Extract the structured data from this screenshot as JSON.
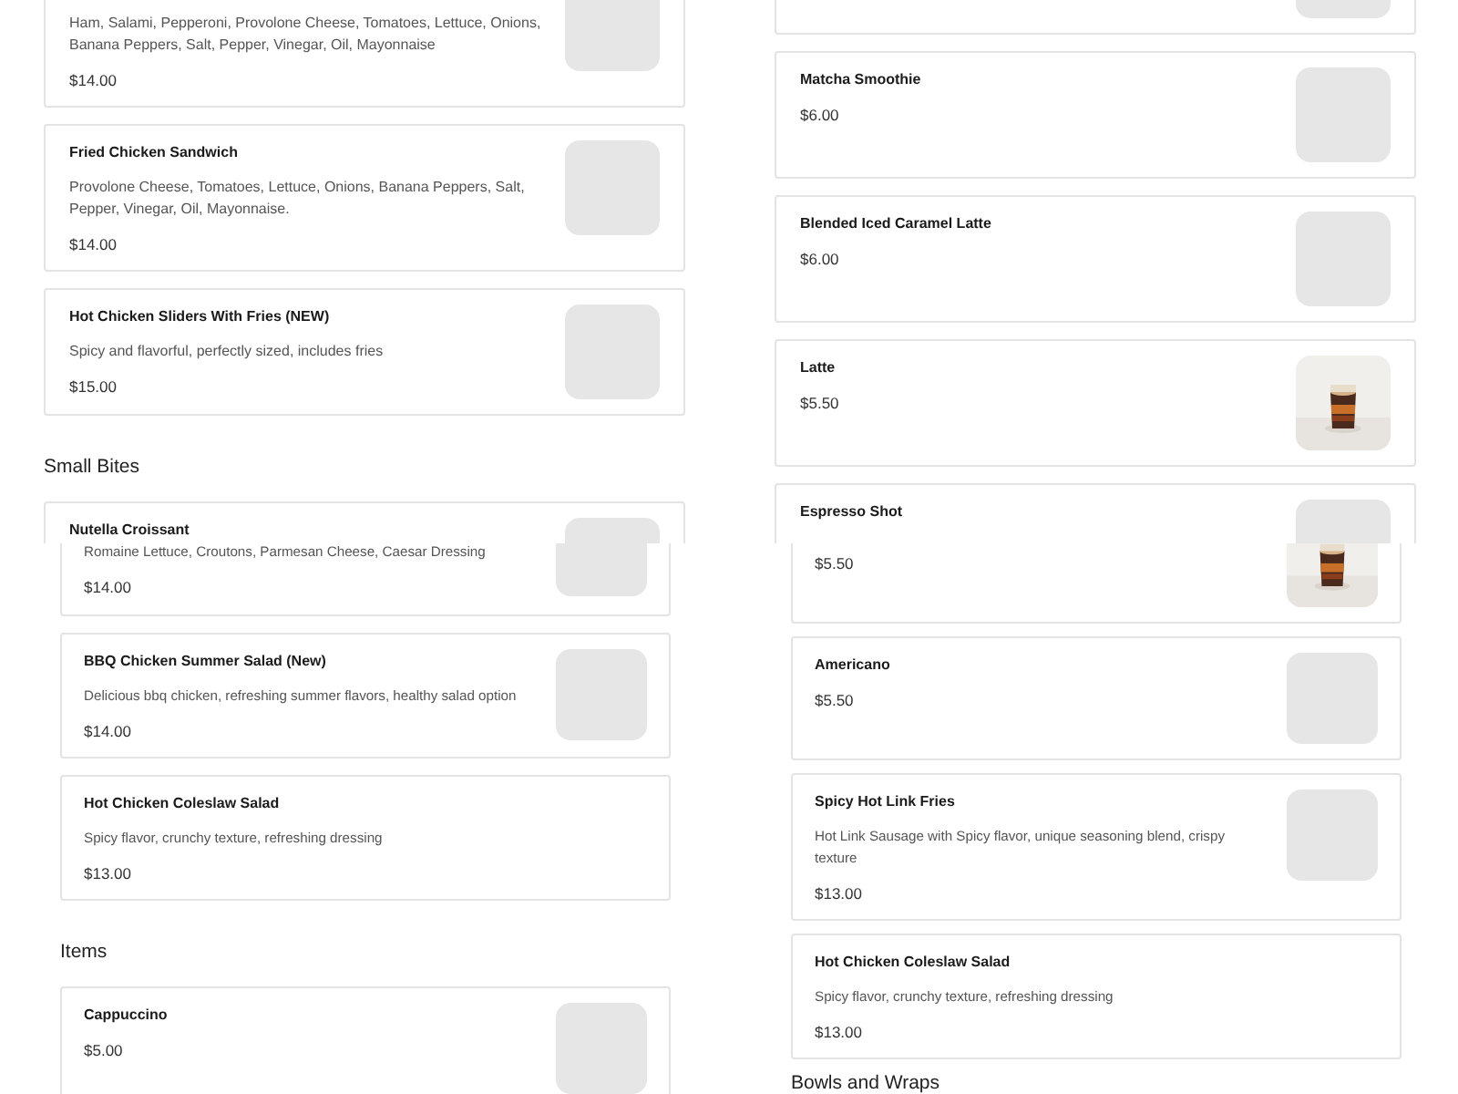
{
  "views": [
    {
      "columns": [
        {
          "entries": [
            {
              "kind": "card",
              "description": "Ham, Salami, Pepperoni, Provolone Cheese, Tomatoes, Lettuce, Onions, Banana Peppers, Salt, Pepper, Vinegar, Oil, Mayonnaise",
              "price": "$14.00"
            },
            {
              "kind": "card",
              "name": "Fried Chicken Sandwich",
              "description": "Provolone Cheese, Tomatoes, Lettuce, Onions, Banana Peppers, Salt, Pepper, Vinegar, Oil, Mayonnaise.",
              "price": "$14.00"
            },
            {
              "kind": "card",
              "name": "Hot Chicken Sliders With Fries (NEW)",
              "description": "Spicy and flavorful, perfectly sized, includes fries",
              "price": "$15.00"
            },
            {
              "kind": "heading",
              "text": "Small Bites"
            },
            {
              "kind": "card",
              "name": "Nutella Croissant"
            }
          ]
        },
        {
          "entries": [
            {
              "kind": "card"
            },
            {
              "kind": "card",
              "name": "Matcha Smoothie",
              "price": "$6.00"
            },
            {
              "kind": "card",
              "name": "Blended Iced Caramel Latte",
              "price": "$6.00"
            },
            {
              "kind": "photo_card",
              "name": "Latte",
              "price": "$5.50"
            },
            {
              "kind": "card",
              "name": "Espresso Shot"
            }
          ]
        }
      ]
    },
    {
      "columns": [
        {
          "entries": [
            {
              "kind": "card",
              "description": "Romaine Lettuce, Croutons, Parmesan Cheese, Caesar Dressing",
              "price": "$14.00"
            },
            {
              "kind": "card",
              "name": "BBQ Chicken Summer Salad (New)",
              "description": "Delicious bbq chicken, refreshing summer flavors, healthy salad option",
              "price": "$14.00"
            },
            {
              "kind": "text_card",
              "name": "Hot Chicken Coleslaw Salad",
              "description": "Spicy flavor, crunchy texture, refreshing dressing",
              "price": "$13.00"
            },
            {
              "kind": "heading",
              "text": "Items"
            },
            {
              "kind": "card",
              "name": "Cappuccino",
              "price": "$5.00"
            }
          ]
        },
        {
          "entries": [
            {
              "kind": "photo_card",
              "price": "$5.50"
            },
            {
              "kind": "card",
              "name": "Americano",
              "price": "$5.50"
            },
            {
              "kind": "card",
              "name": "Spicy Hot Link Fries",
              "description": "Hot Link Sausage with Spicy flavor, unique seasoning blend, crispy texture",
              "price": "$13.00"
            },
            {
              "kind": "text_card",
              "name": "Hot Chicken Coleslaw Salad",
              "description": "Spicy flavor, crunchy texture, refreshing dressing",
              "price": "$13.00"
            },
            {
              "kind": "heading",
              "text": "Bowls and Wraps"
            }
          ]
        }
      ]
    }
  ]
}
